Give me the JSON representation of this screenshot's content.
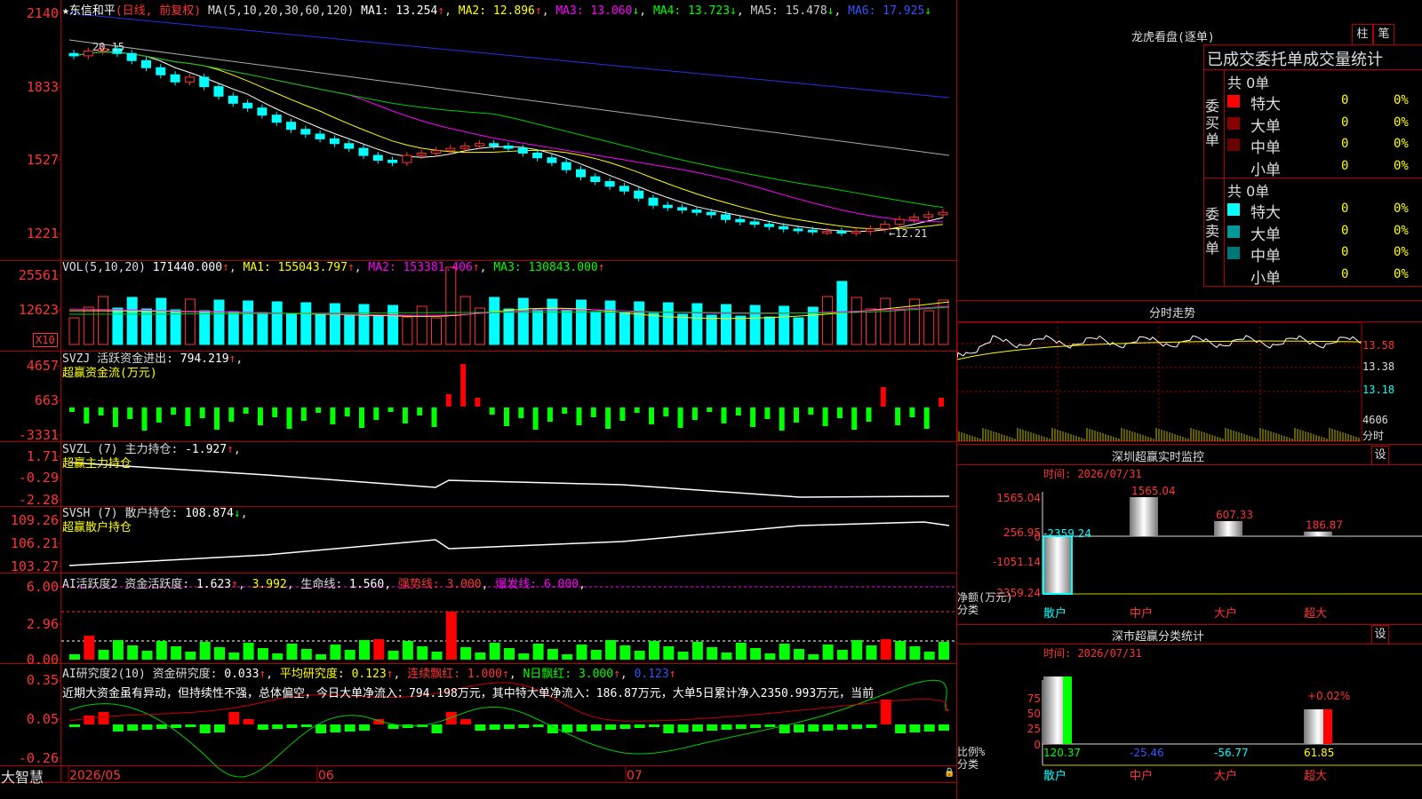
{
  "app": {
    "brand": "大智慧"
  },
  "kline": {
    "stock_name": "★东信和平",
    "period": "(日线, 前复权)",
    "ma_title": "MA(5,10,20,30,60,120)",
    "ma_values": [
      {
        "label": "MA1:",
        "value": "13.254",
        "arrow": "↑",
        "color": "#ffffff"
      },
      {
        "label": "MA2:",
        "value": "12.896",
        "arrow": "↑",
        "color": "#ffff00"
      },
      {
        "label": "MA3:",
        "value": "13.060",
        "arrow": "↓",
        "color": "#ff00ff"
      },
      {
        "label": "MA4:",
        "value": "13.723",
        "arrow": "↓",
        "color": "#00ff00"
      },
      {
        "label": "MA5:",
        "value": "15.478",
        "arrow": "↓",
        "color": "#cccccc"
      },
      {
        "label": "MA6:",
        "value": "17.925",
        "arrow": "↓",
        "color": "#3355ff"
      }
    ],
    "y_ticks": [
      "2140",
      "1833",
      "1527",
      "1221"
    ],
    "high_label": "20.15",
    "low_label": "←12.21"
  },
  "vol": {
    "title": "VOL(5,10,20)",
    "value": "171440.000",
    "arrow": "↑",
    "ma": [
      {
        "label": "MA1:",
        "value": "155043.797",
        "arrow": "↑",
        "color": "#ffff00"
      },
      {
        "label": "MA2:",
        "value": "153381.406",
        "arrow": "↑",
        "color": "#ff00ff"
      },
      {
        "label": "MA3:",
        "value": "130843.000",
        "arrow": "↑",
        "color": "#00ff00"
      }
    ],
    "y_ticks": [
      "25561",
      "12623"
    ],
    "unit": "X10"
  },
  "svzj": {
    "title": "SVZJ",
    "label": "活跃资金进出:",
    "value": "794.219",
    "arrow": "↑",
    "subtitle": "超赢资金流(万元)",
    "y_ticks": [
      "4657",
      "663",
      "-3331"
    ]
  },
  "svzl": {
    "title": "SVZL (7)",
    "label": "主力持仓:",
    "value": "-1.927",
    "arrow": "↑",
    "subtitle": "超赢主力持仓",
    "y_ticks": [
      "1.71",
      "-0.29",
      "-2.28"
    ]
  },
  "svsh": {
    "title": "SVSH (7)",
    "label": "散户持仓:",
    "value": "108.874",
    "arrow": "↓",
    "subtitle": "超赢散户持仓",
    "y_ticks": [
      "109.26",
      "106.21",
      "103.27"
    ]
  },
  "ai1": {
    "title": "AI活跃度2",
    "label": "资金活跃度:",
    "value1": "1.623",
    "arrow1": "↑",
    "value2": "3.992",
    "life_label": "生命线:",
    "life": "1.560",
    "strong_label": "强势线:",
    "strong": "3.000",
    "burst_label": "爆发线:",
    "burst": "6.000",
    "y_ticks": [
      "6.00",
      "2.96",
      "0.00"
    ]
  },
  "ai2": {
    "title": "AI研究度2(10)",
    "label": "资金研究度:",
    "value": "0.033",
    "arrow": "↑",
    "avg_label": "平均研究度:",
    "avg": "0.123",
    "avg_arrow": "↑",
    "cont_label": "连续飘红:",
    "cont": "1.000",
    "cont_arrow": "↑",
    "n_label": "N日飘红:",
    "n": "3.000",
    "n_arrow": "↑",
    "last": "0.123",
    "last_arrow": "↑",
    "y_ticks": [
      "0.35",
      "0.05",
      "-0.26"
    ],
    "note": "近期大资金虽有异动，但持续性不强，总体偏空，今日大单净流入：794.198万元，其中特大单净流入：186.87万元，大单5日累计净入2350.993万元，当前"
  },
  "x_axis": [
    "2026/05",
    "06",
    "07"
  ],
  "lhb": {
    "title": "龙虎看盘(逐单)",
    "btn_zhu": "柱",
    "btn_bi": "笔",
    "sub": "已成交委托单成交量统计",
    "buy": {
      "side": "委买单",
      "total": "共 0单",
      "rows": [
        {
          "name": "特大",
          "vol": "0",
          "pct": "0%",
          "color": "#ff0000"
        },
        {
          "name": "大单",
          "vol": "0",
          "pct": "0%",
          "color": "#8b0000"
        },
        {
          "name": "中单",
          "vol": "0",
          "pct": "0%",
          "color": "#6a0000"
        },
        {
          "name": "小单",
          "vol": "0",
          "pct": "0%",
          "color": "#000000"
        }
      ]
    },
    "sell": {
      "side": "委卖单",
      "total": "共 0单",
      "rows": [
        {
          "name": "特大",
          "vol": "0",
          "pct": "0%",
          "color": "#00ffff"
        },
        {
          "name": "大单",
          "vol": "0",
          "pct": "0%",
          "color": "#009999"
        },
        {
          "name": "中单",
          "vol": "0",
          "pct": "0%",
          "color": "#007777"
        },
        {
          "name": "小单",
          "vol": "0",
          "pct": "0%",
          "color": "#000000"
        }
      ]
    }
  },
  "intraday": {
    "title": "分时走势",
    "y_ticks": [
      "13.58",
      "13.38",
      "13.18"
    ],
    "vol_tick": "4606",
    "vol_label": "分时"
  },
  "monitor": {
    "title": "深圳超赢实时监控",
    "btn": "设",
    "time_label": "时间: 2026/07/31",
    "y_ticks": [
      "1565.04",
      "256.95",
      "0",
      "-1051.14",
      "-2359.24"
    ],
    "unit1": "净额(万元)",
    "unit2": "分类",
    "bars": [
      {
        "cat": "散户",
        "value": -2359.24,
        "label": "-2359.24"
      },
      {
        "cat": "中户",
        "value": 1565.04,
        "label": "1565.04"
      },
      {
        "cat": "大户",
        "value": 607.33,
        "label": "607.33"
      },
      {
        "cat": "超大",
        "value": 186.87,
        "label": "186.87"
      }
    ]
  },
  "classify": {
    "title": "深市超赢分类统计",
    "btn": "设",
    "time_label": "时间: 2026/07/31",
    "y_ticks": [
      "75",
      "50",
      "25",
      "0"
    ],
    "unit1": "比例%",
    "unit2": "分类",
    "bars": [
      {
        "cat": "散户",
        "value": 120.37,
        "label": "120.37",
        "color": "#00ff00"
      },
      {
        "cat": "中户",
        "value": -25.46,
        "label": "-25.46",
        "color": "#3355ff"
      },
      {
        "cat": "大户",
        "value": -56.77,
        "label": "-56.77",
        "color": "#00ffff"
      },
      {
        "cat": "超大",
        "value": 61.85,
        "label": "61.85",
        "color": "#ffff00"
      }
    ],
    "annot": "+0.02%"
  }
}
